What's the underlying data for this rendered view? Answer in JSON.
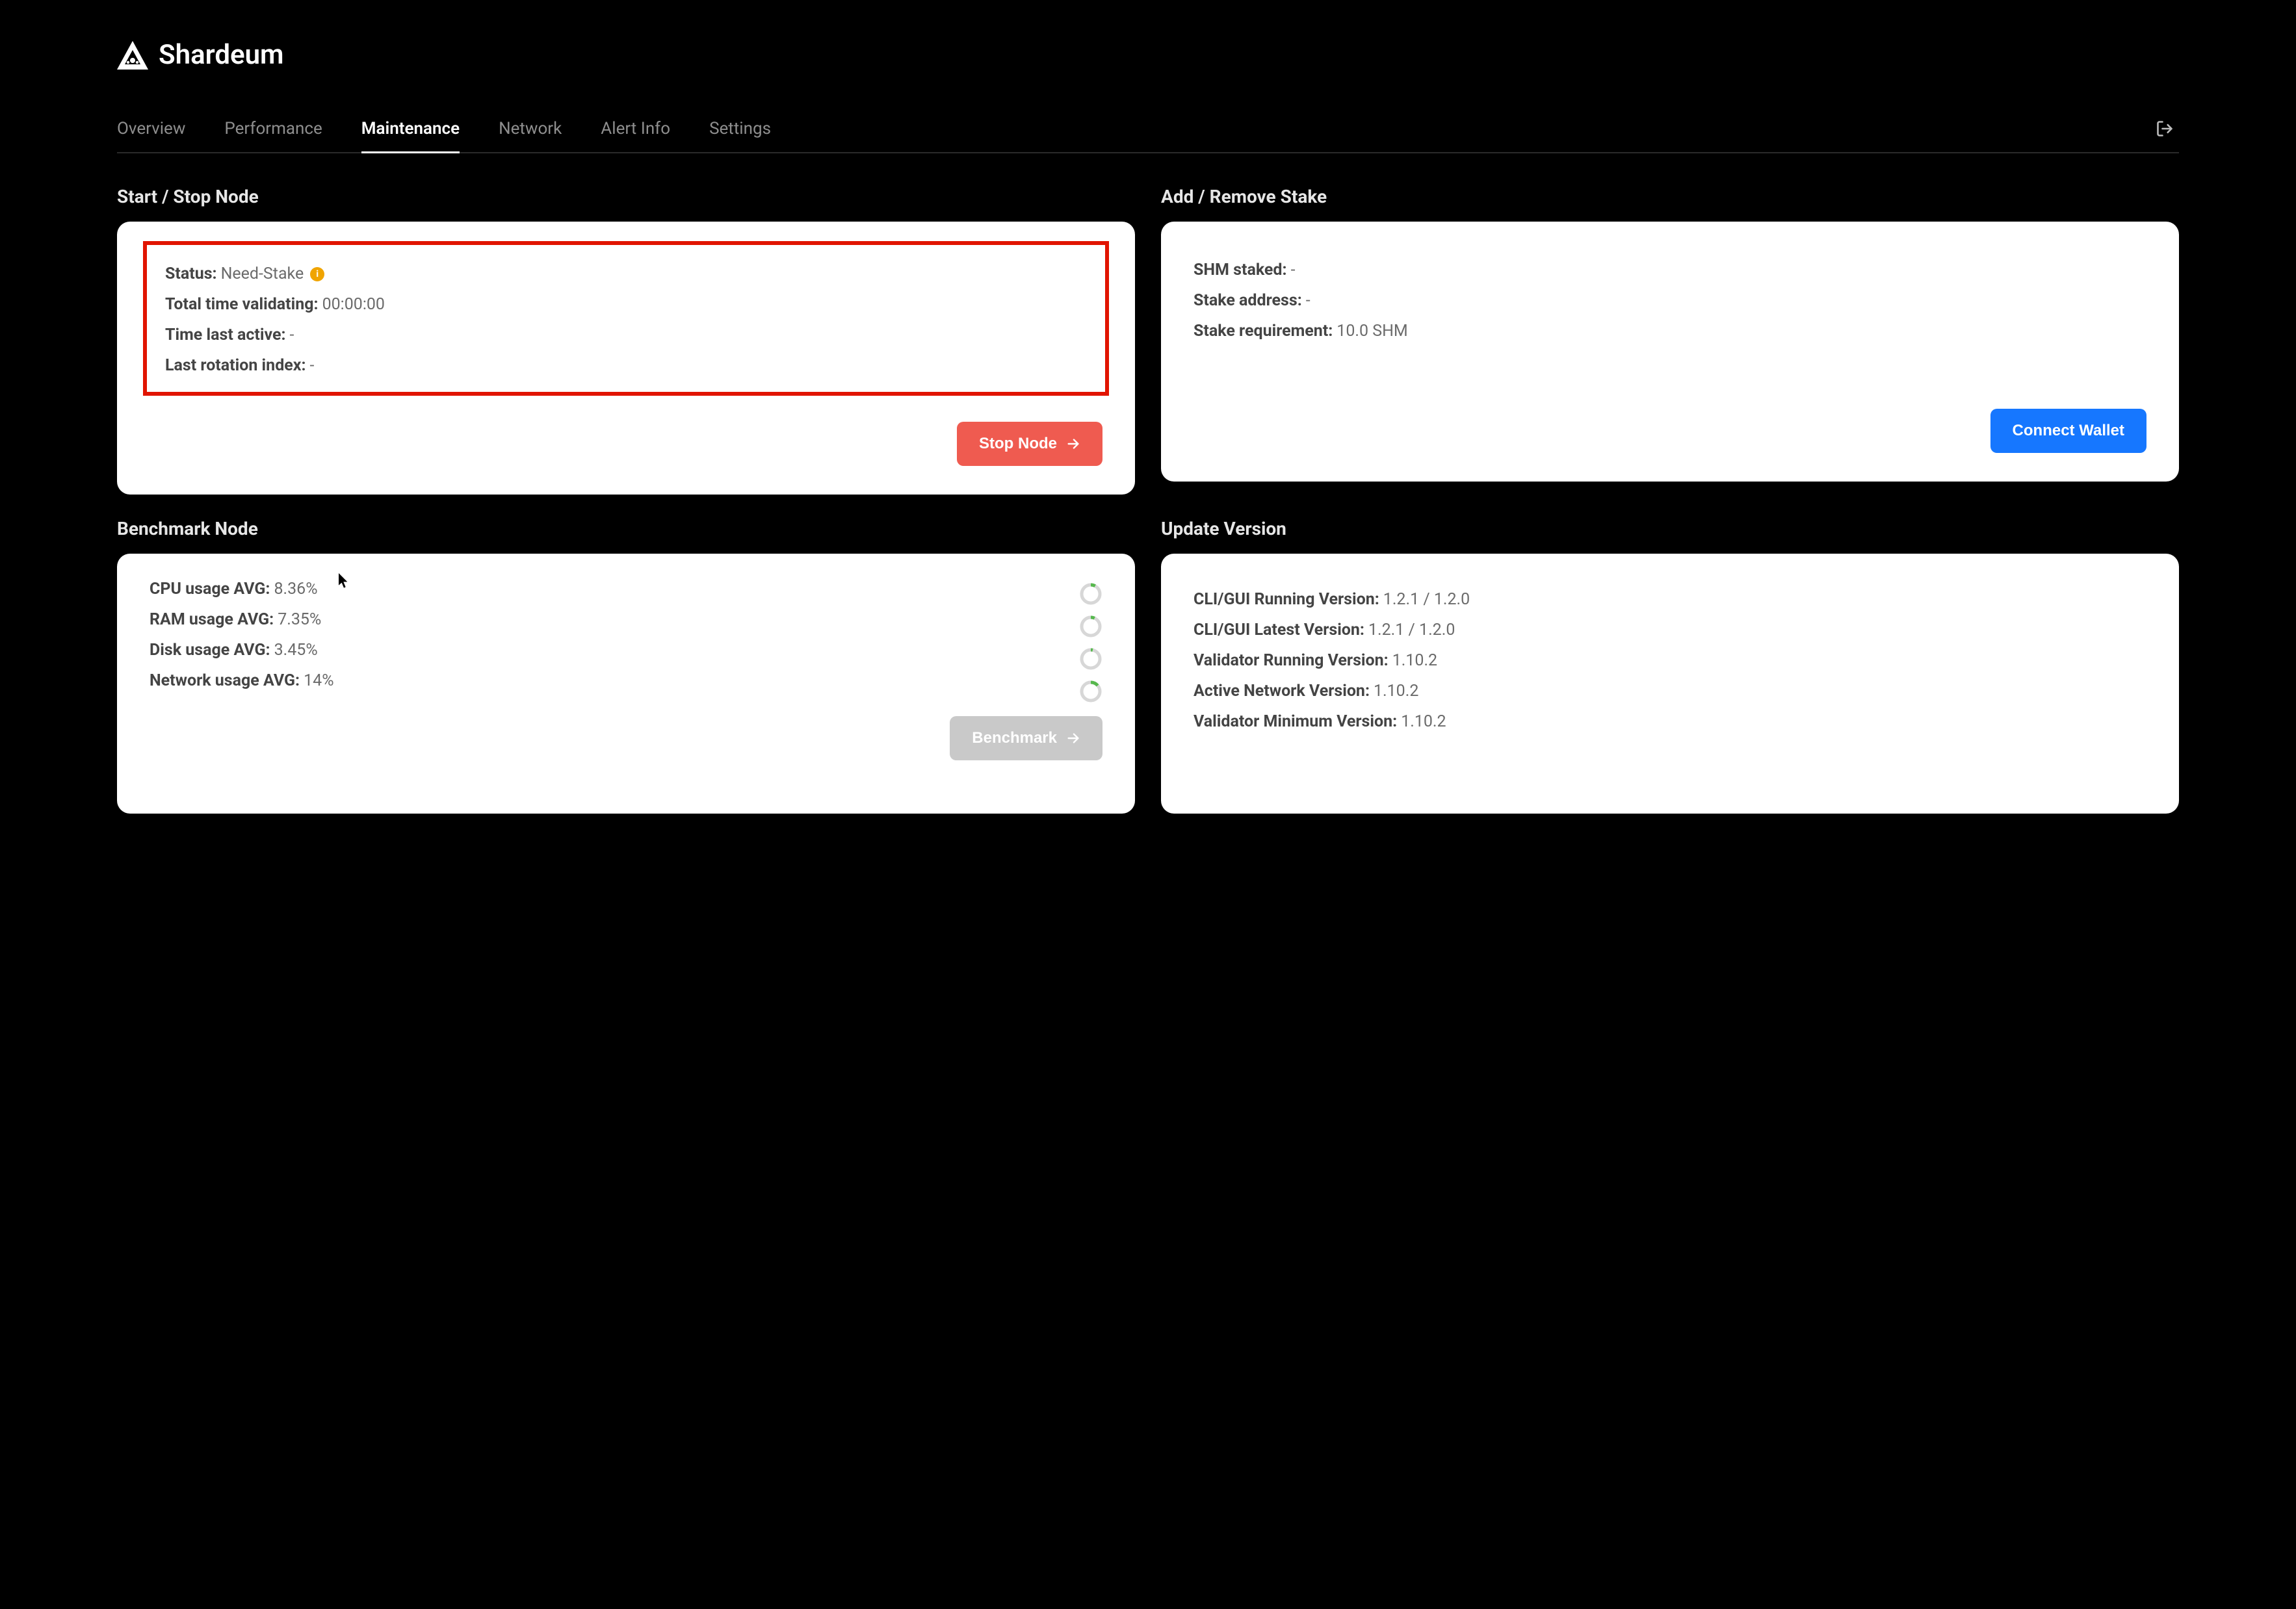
{
  "brand": "Shardeum",
  "nav": {
    "tabs": [
      "Overview",
      "Performance",
      "Maintenance",
      "Network",
      "Alert Info",
      "Settings"
    ],
    "active_index": 2
  },
  "sections": {
    "start_stop": {
      "title": "Start / Stop Node",
      "status_label": "Status:",
      "status_value": "Need-Stake",
      "total_time_label": "Total time validating:",
      "total_time_value": "00:00:00",
      "last_active_label": "Time last active:",
      "last_active_value": "-",
      "rotation_label": "Last rotation index:",
      "rotation_value": "-",
      "button": "Stop Node"
    },
    "stake": {
      "title": "Add / Remove Stake",
      "shm_staked_label": "SHM staked:",
      "shm_staked_value": "-",
      "stake_address_label": "Stake address:",
      "stake_address_value": "-",
      "stake_req_label": "Stake requirement:",
      "stake_req_value": "10.0 SHM",
      "button": "Connect Wallet"
    },
    "benchmark": {
      "title": "Benchmark Node",
      "cpu_label": "CPU usage AVG:",
      "cpu_value": "8.36%",
      "ram_label": "RAM usage AVG:",
      "ram_value": "7.35%",
      "disk_label": "Disk usage AVG:",
      "disk_value": "3.45%",
      "net_label": "Network usage AVG:",
      "net_value": "14%",
      "button": "Benchmark"
    },
    "version": {
      "title": "Update Version",
      "cli_running_label": "CLI/GUI Running Version:",
      "cli_running_value": "1.2.1 / 1.2.0",
      "cli_latest_label": "CLI/GUI Latest Version:",
      "cli_latest_value": "1.2.1 / 1.2.0",
      "validator_running_label": "Validator Running Version:",
      "validator_running_value": "1.10.2",
      "active_network_label": "Active Network Version:",
      "active_network_value": "1.10.2",
      "validator_min_label": "Validator Minimum Version:",
      "validator_min_value": "1.10.2"
    }
  }
}
